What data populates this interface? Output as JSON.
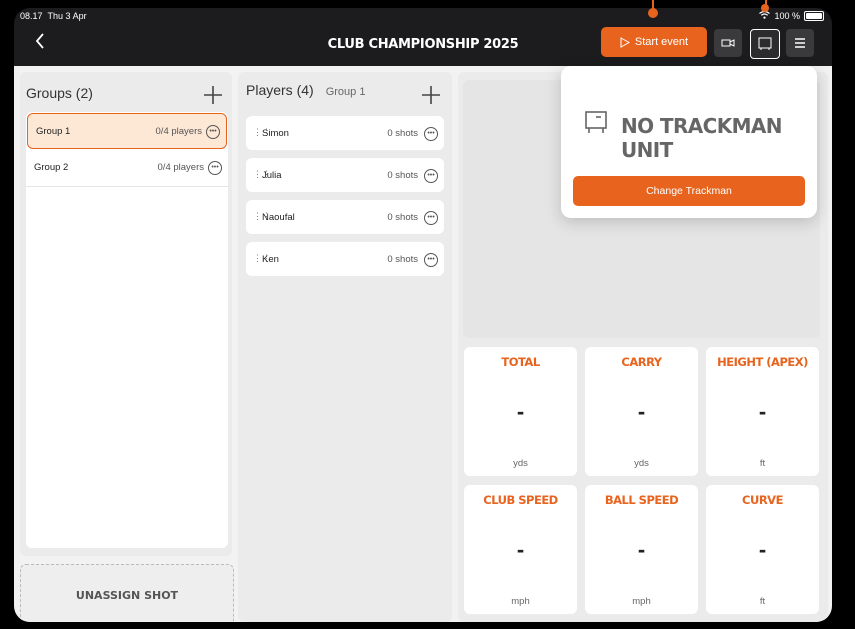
{
  "status_bar": {
    "time": "08.17",
    "date": "Thu 3 Apr",
    "battery": "100 %"
  },
  "nav": {
    "back_icon": "chevron-left-icon",
    "title": "CLUB CHAMPIONSHIP 2025",
    "start_event_label": "Start event"
  },
  "groups": {
    "header": "Groups (2)",
    "items": [
      {
        "name": "Group 1",
        "count": "0/4 players",
        "selected": true
      },
      {
        "name": "Group 2",
        "count": "0/4 players",
        "selected": false
      }
    ],
    "unassign_label": "UNASSIGN SHOT"
  },
  "players": {
    "header": "Players (4)",
    "group": "Group 1",
    "items": [
      {
        "name": "Simon",
        "shots": "0 shots"
      },
      {
        "name": "Julia",
        "shots": "0 shots"
      },
      {
        "name": "Naoufal",
        "shots": "0 shots"
      },
      {
        "name": "Ken",
        "shots": "0 shots"
      }
    ]
  },
  "stats": [
    {
      "label": "TOTAL",
      "value": "-",
      "unit": "yds"
    },
    {
      "label": "CARRY",
      "value": "-",
      "unit": "yds"
    },
    {
      "label": "HEIGHT (APEX)",
      "value": "-",
      "unit": "ft"
    },
    {
      "label": "CLUB SPEED",
      "value": "-",
      "unit": "mph"
    },
    {
      "label": "BALL SPEED",
      "value": "-",
      "unit": "mph"
    },
    {
      "label": "CURVE",
      "value": "-",
      "unit": "ft"
    }
  ],
  "popover": {
    "message": "NO TRACKMAN UNIT",
    "button_label": "Change Trackman"
  },
  "colors": {
    "accent": "#e8641e"
  }
}
